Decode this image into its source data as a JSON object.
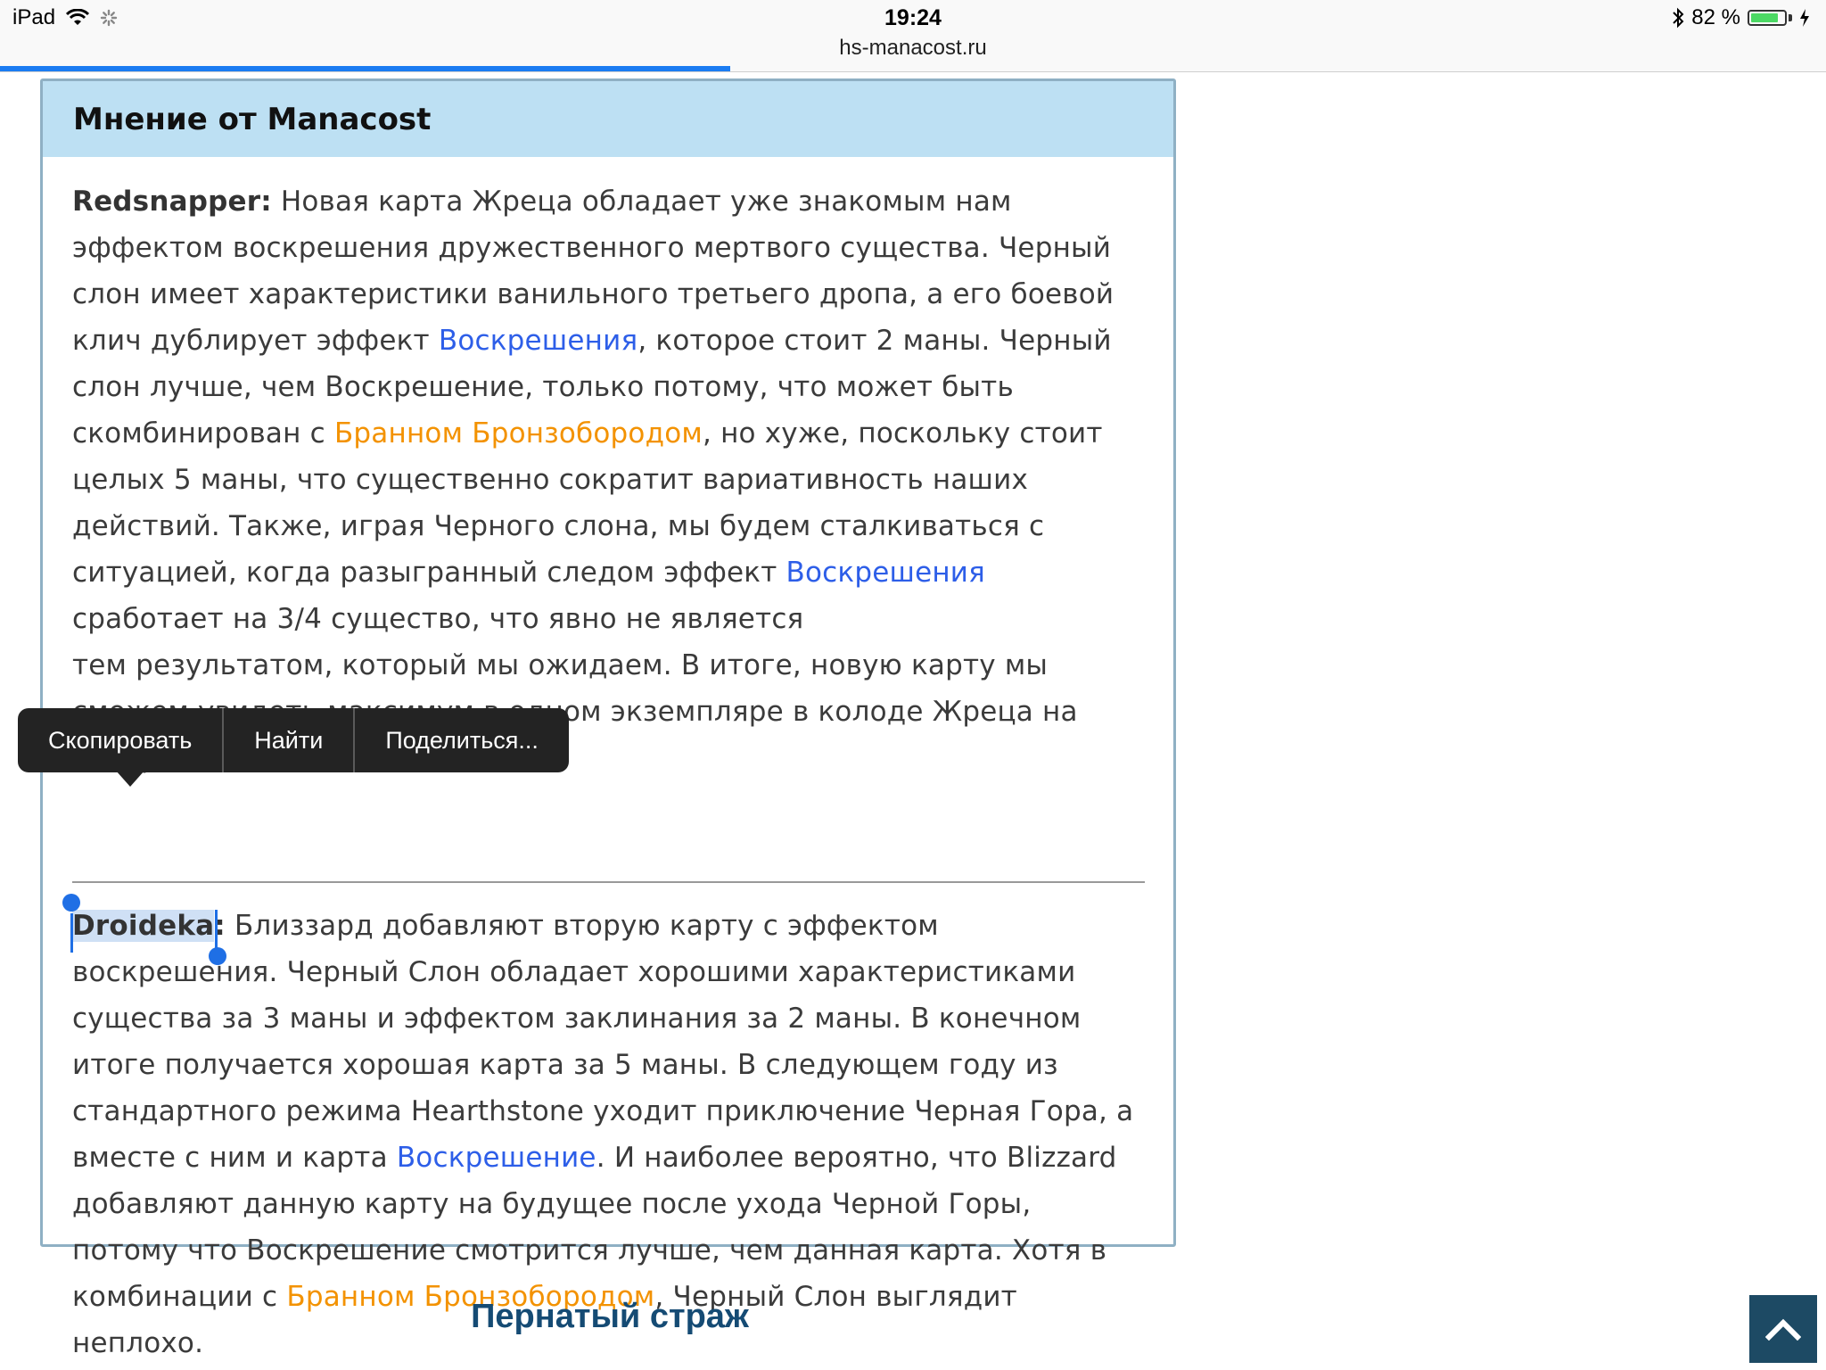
{
  "status_bar": {
    "device": "iPad",
    "time": "19:24",
    "url": "hs-manacost.ru",
    "battery_text": "82 %",
    "battery_level": 0.82,
    "page_load_progress": 0.4
  },
  "opinion": {
    "title": "Мнение от Manacost",
    "p1": {
      "author": "Redsnapper:",
      "t1": " Новая карта Жреца обладает уже знакомым нам эффектом воскрешения дружественного мертвого существа. Черный слон имеет характеристики ванильного третьего дропа, а его боевой клич дублирует эффект ",
      "l1": "Воскрешения",
      "t2": ", которое стоит 2 маны. Черный слон лучше, чем Воскрешение, только потому, что может быть скомбинирован с ",
      "l2": "Бранном Бронзобородом",
      "t3": ", но хуже, поскольку стоит целых 5 маны, что существенно сократит вариативность наших действий. Также, играя Черного слона, мы будем сталкиваться с ситуацией, когда разыгранный следом эффект ",
      "l3": "Воскрешения",
      "t4": " сработает на 3/4 существо, что явно не является",
      "t5": "тем результатом, который мы ожидаем. В итоге, новую карту мы сможем увидеть максимум в одном экземпляре в колоде Жреца на Воскрешении, то"
    },
    "p2": {
      "author": "Droideka",
      "colon": ":",
      "t1": " Близзард добавляют вторую карту с эффектом воскрешения. Черный Слон обладает хорошими характеристиками существа за 3 маны и эффектом заклинания за 2 маны. В конечном итоге получается хорошая карта за 5 маны. В следующем году из стандартного режима Hearthstone уходит приключение Черная Гора, а вместе с ним и карта ",
      "l1": "Воскрешение",
      "t2": ". И наиболее вероятно, что Blizzard добавляют данную карту на будущее после ухода Черной Горы, потому что Воскрешение смотрится лучше, чем данная карта. Хотя в комбинации с ",
      "l2": "Бранном Бронзобородом",
      "t3": ", Черный Слон выглядит неплохо."
    }
  },
  "context_menu": {
    "copy": "Скопировать",
    "find": "Найти",
    "share": "Поделиться..."
  },
  "next_section": {
    "title": "Пернатый страж"
  },
  "icons": {
    "wifi": "wifi-icon",
    "activity": "loading-spinner-icon",
    "bluetooth": "bluetooth-icon",
    "battery": "battery-icon",
    "charging": "charging-bolt-icon",
    "scroll_top": "chevron-up-icon"
  },
  "colors": {
    "link_blue": "#2d5ee8",
    "link_orange": "#f39200",
    "header_bg": "#bde0f3",
    "scroll_btn": "#1d4a64"
  }
}
